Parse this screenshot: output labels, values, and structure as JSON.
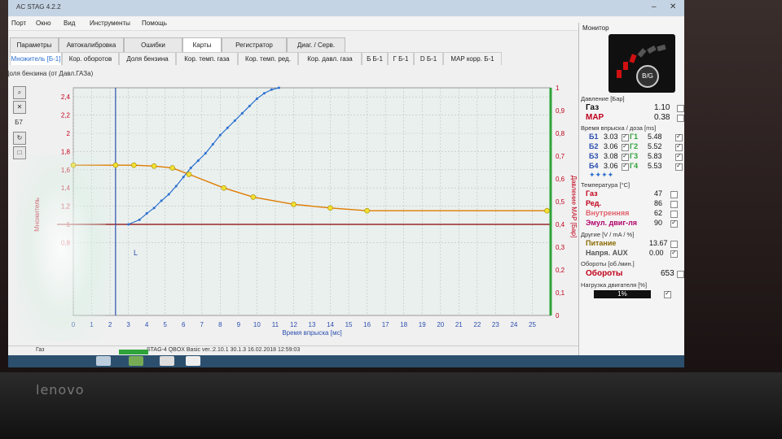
{
  "window": {
    "title": "AC STAG 4.2.2"
  },
  "menu": [
    "Порт",
    "Окно",
    "Вид",
    "Инструменты",
    "Помощь"
  ],
  "main_tabs": [
    "Параметры",
    "Автокалибровка",
    "Ошибки",
    "Карты",
    "Регистратор",
    "Диаг. / Серв."
  ],
  "active_main_tab": "Карты",
  "sub_tabs": [
    "Множитель [Б-1]",
    "Кор. оборотов",
    "Доля бензина",
    "Кор. темп. газа",
    "Кор. темп. ред.",
    "Кор. давл. газа",
    "Б Б-1",
    "Г Б-1",
    "D Б-1",
    "MAP корр. Б-1"
  ],
  "active_sub_tab": "Множитель [Б-1]",
  "chart_title_label": "Доля бензина (от Давл.ГАЗа)",
  "toolbar": {
    "b7_label": "Б7"
  },
  "chart_data": {
    "type": "line",
    "xlabel": "Время впрыска [мс]",
    "ylabel_left": "Множитель",
    "ylabel_right": "Давление MAP [Бар]",
    "x_ticks": [
      0,
      1,
      2,
      3,
      4,
      5,
      6,
      7,
      8,
      9,
      10,
      11,
      12,
      13,
      14,
      15,
      16,
      17,
      18,
      19,
      20,
      21,
      22,
      23,
      24,
      25
    ],
    "y_left_ticks": [
      "0,8",
      "1",
      "1,2",
      "1,4",
      "1,6",
      "1,8",
      "2",
      "2,2",
      "2,4"
    ],
    "y_right_ticks": [
      "0",
      "0,1",
      "0,2",
      "0,3",
      "0,4",
      "0,5",
      "0,6",
      "0,7",
      "0,8",
      "0,9",
      "1"
    ],
    "xlim": [
      0,
      26
    ],
    "ylim_left": [
      0.0,
      2.5
    ],
    "ylim_right": [
      0,
      1
    ],
    "series": [
      {
        "x": [
          0,
          2.3,
          3.3,
          4.4,
          5.4,
          6.3,
          8.2,
          9.8,
          12.0,
          14.0,
          16.0,
          25.8
        ],
        "y": [
          1.65,
          1.65,
          1.65,
          1.64,
          1.62,
          1.55,
          1.4,
          1.3,
          1.22,
          1.18,
          1.15,
          1.15
        ],
        "color": "#e07b00",
        "markers": "yellow"
      }
    ],
    "scatter_points": {
      "x": [
        3.0,
        3.6,
        4.0,
        4.4,
        4.8,
        5.2,
        5.6,
        6.0,
        6.4,
        6.8,
        7.2,
        7.6,
        8.0,
        8.4,
        8.8,
        9.2,
        9.6,
        10.0,
        10.4,
        10.8,
        11.2
      ],
      "y": [
        1.0,
        1.05,
        1.12,
        1.18,
        1.26,
        1.33,
        1.42,
        1.52,
        1.62,
        1.7,
        1.78,
        1.88,
        1.98,
        2.06,
        2.14,
        2.22,
        2.3,
        2.38,
        2.44,
        2.48,
        2.5
      ],
      "color": "#2b6fd0"
    },
    "reference_lines": {
      "horizontal_y": 1.0,
      "horizontal_color": "#8b0000",
      "vertical_x": 2.3,
      "vertical_color": "#2b4fb0",
      "right_green_axis": "#2fa43a"
    },
    "cursor_label": "L"
  },
  "monitor": {
    "title": "Монитор",
    "gauge_label": "B/G",
    "pressure_section": "Давление [Бар]",
    "pressure": [
      {
        "name": "Газ",
        "value": "1.10",
        "color": "#111"
      },
      {
        "name": "MAP",
        "value": "0.38",
        "color": "#c0001a"
      }
    ],
    "inj_section": "Время впрыска / доза [ms]",
    "inj_rows": [
      {
        "b": "Б1",
        "bv": "3.03",
        "g": "Г1",
        "gv": "5.48"
      },
      {
        "b": "Б2",
        "bv": "3.06",
        "g": "Г2",
        "gv": "5.52"
      },
      {
        "b": "Б3",
        "bv": "3.08",
        "g": "Г3",
        "gv": "5.83"
      },
      {
        "b": "Б4",
        "bv": "3.06",
        "g": "Г4",
        "gv": "5.53"
      }
    ],
    "temp_section": "Температура [°C]",
    "temps": [
      {
        "name": "Газ",
        "value": "47",
        "color": "#c0001a"
      },
      {
        "name": "Ред.",
        "value": "86",
        "color": "#c0001a"
      },
      {
        "name": "Внутренняя",
        "value": "62",
        "color": "#e0606a"
      },
      {
        "name": "Эмул. двиг-ля",
        "value": "90",
        "color": "#b0006a"
      }
    ],
    "other_section": "Другие [V / mA / %]",
    "others": [
      {
        "name": "Питание",
        "value": "13.67",
        "color": "#8a6a00"
      },
      {
        "name": "Напря. AUX",
        "value": "0.00",
        "color": "#555"
      }
    ],
    "rpm_section": "Обороты [об./мин.]",
    "rpm": {
      "name": "Обороты",
      "value": "653",
      "color": "#c0001a"
    },
    "load_section": "Нагрузка двигателя [%]",
    "load_value": "1%"
  },
  "status": {
    "text": "STAG-4 QBOX Basic  ver.:2.10.1  30.1.3   16.02.2018 12:59:03",
    "gas_label": "Газ"
  }
}
